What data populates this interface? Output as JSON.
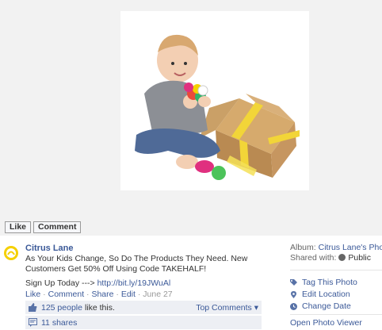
{
  "photo": {
    "alt": "Baby holding colorful toy next to open cardboard box",
    "box_color": "#c9985a",
    "ribbon_color": "#f2d538"
  },
  "actions": {
    "like_label": "Like",
    "comment_label": "Comment"
  },
  "post": {
    "page_name": "Citrus Lane",
    "text": "As Your Kids Change, So Do The Products They Need. New Customers Get 50% Off Using Code TAKEHALF!",
    "signup_prefix": "Sign Up Today ---> ",
    "signup_link": "http://bit.ly/19JWuAl",
    "action_like": "Like",
    "action_comment": "Comment",
    "action_share": "Share",
    "action_edit": "Edit",
    "date": "June 27",
    "likes_count": "125 people",
    "likes_rest": "like this.",
    "top_comments": "Top Comments",
    "shares": "11 shares"
  },
  "meta": {
    "album_label": "Album:",
    "album_name": "Citrus Lane's Photo",
    "shared_label": "Shared with:",
    "shared_value": "Public",
    "tag_photo": "Tag This Photo",
    "edit_location": "Edit Location",
    "change_date": "Change Date",
    "open_viewer": "Open Photo Viewer"
  },
  "colors": {
    "link": "#3b5998",
    "brand_yellow": "#f5d000"
  }
}
